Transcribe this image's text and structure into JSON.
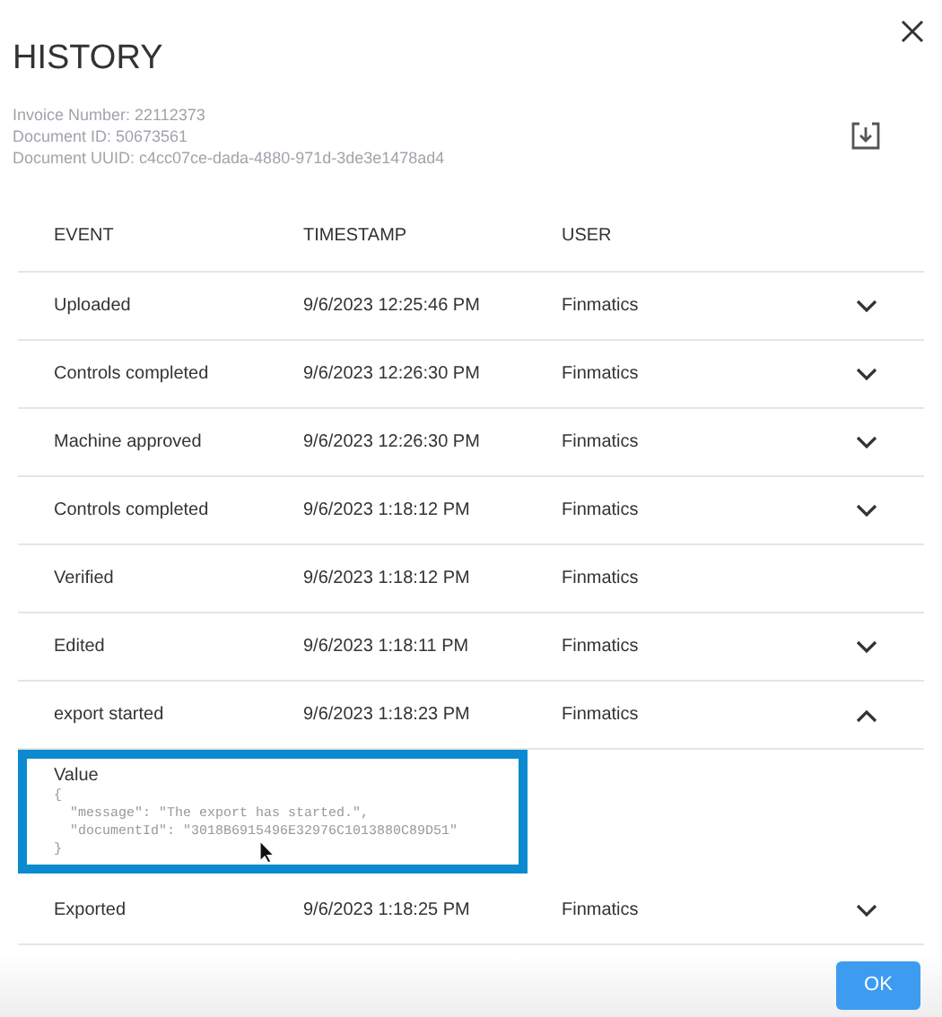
{
  "dialog": {
    "title": "HISTORY",
    "meta": [
      "Invoice Number: 22112373",
      "Document ID: 50673561",
      "Document UUID: c4cc07ce-dada-4880-971d-3de3e1478ad4"
    ]
  },
  "table": {
    "columns": [
      "EVENT",
      "TIMESTAMP",
      "USER"
    ],
    "rows": [
      {
        "event": "Uploaded",
        "timestamp": "9/6/2023 12:25:46 PM",
        "user": "Finmatics",
        "expanded": false
      },
      {
        "event": "Controls completed",
        "timestamp": "9/6/2023 12:26:30 PM",
        "user": "Finmatics",
        "expanded": false
      },
      {
        "event": "Machine approved",
        "timestamp": "9/6/2023 12:26:30 PM",
        "user": "Finmatics",
        "expanded": false
      },
      {
        "event": "Controls completed",
        "timestamp": "9/6/2023 1:18:12 PM",
        "user": "Finmatics",
        "expanded": false
      },
      {
        "event": "Verified",
        "timestamp": "9/6/2023 1:18:12 PM",
        "user": "Finmatics"
      },
      {
        "event": "Edited",
        "timestamp": "9/6/2023 1:18:11 PM",
        "user": "Finmatics",
        "expanded": false
      },
      {
        "event": "export started",
        "timestamp": "9/6/2023 1:18:23 PM",
        "user": "Finmatics",
        "expanded": true,
        "details": {
          "label": "Value",
          "highlighted": true,
          "lines": [
            "{",
            "  \"message\": \"The export has started.\",",
            "  \"documentId\": \"3018B6915496E32976C1013880C89D51\"",
            "}"
          ]
        }
      },
      {
        "event": "Exported",
        "timestamp": "9/6/2023 1:18:25 PM",
        "user": "Finmatics",
        "expanded": false
      }
    ]
  },
  "buttons": [
    "OK"
  ]
}
